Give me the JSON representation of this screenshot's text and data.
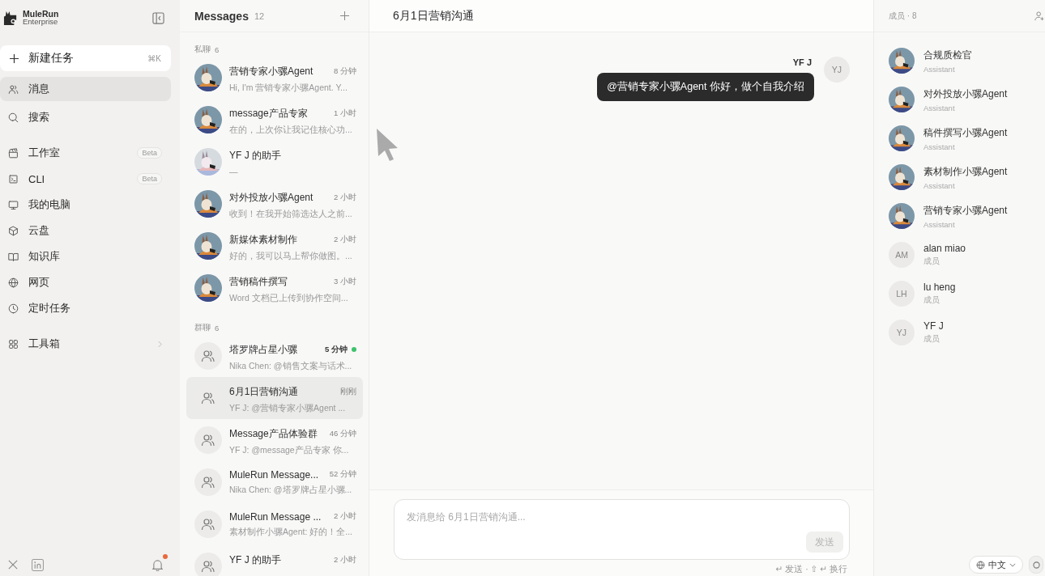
{
  "sidebar": {
    "logo": {
      "name": "MuleRun",
      "edition": "Enterprise"
    },
    "new_task": {
      "label": "新建任务",
      "shortcut": "⌘K"
    },
    "nav_groups": [
      [
        {
          "label": "消息",
          "selected": true,
          "expandable": false
        },
        {
          "label": "搜索",
          "selected": false,
          "expandable": false
        }
      ],
      [
        {
          "label": "工作室",
          "selected": false,
          "expandable": false,
          "badge": "Beta"
        },
        {
          "label": "CLI",
          "selected": false,
          "expandable": false,
          "badge": "Beta"
        },
        {
          "label": "我的电脑",
          "selected": false,
          "expandable": false
        },
        {
          "label": "云盘",
          "selected": false,
          "expandable": false
        },
        {
          "label": "知识库",
          "selected": false,
          "expandable": false
        },
        {
          "label": "网页",
          "selected": false,
          "expandable": false
        },
        {
          "label": "定时任务",
          "selected": false,
          "expandable": false
        }
      ],
      [
        {
          "label": "工具箱",
          "selected": false,
          "expandable": true
        }
      ]
    ],
    "footer": {
      "notification_dot": true
    }
  },
  "message_list": {
    "title": "Messages",
    "count": "12",
    "sections": [
      {
        "label": "私聊",
        "count": "6",
        "items": [
          {
            "kind": "mule",
            "title": "营销专家小骡Agent",
            "time": "8 分钟",
            "preview": "Hi, I'm 营销专家小骡Agent. Y...",
            "selected": false,
            "unread": false
          },
          {
            "kind": "mule",
            "title": "message产品专家",
            "time": "1 小时",
            "preview": "在的，上次你让我记住核心功...",
            "selected": false,
            "unread": false
          },
          {
            "kind": "mule_light",
            "title": "YF J 的助手",
            "preview": "—",
            "selected": false,
            "unread": false
          },
          {
            "kind": "mule",
            "title": "对外投放小骡Agent",
            "time": "2 小时",
            "preview": "收到！在我开始筛选达人之前...",
            "selected": false,
            "unread": false
          },
          {
            "kind": "mule",
            "title": "新媒体素材制作",
            "time": "2 小时",
            "preview": "好的，我可以马上帮你做图。...",
            "selected": false,
            "unread": false
          },
          {
            "kind": "mule",
            "title": "营销稿件撰写",
            "time": "3 小时",
            "preview": "Word 文档已上传到协作空间...",
            "selected": false,
            "unread": false
          }
        ]
      },
      {
        "label": "群聊",
        "count": "6",
        "items": [
          {
            "kind": "group",
            "title": "塔罗牌占星小骡",
            "time": "5 分钟",
            "preview": "Nika Chen: @销售文案与话术...",
            "selected": false,
            "unread": true
          },
          {
            "kind": "group",
            "title": "6月1日营销沟通",
            "time": "刚刚",
            "preview": "YF J: @营销专家小骡Agent ...",
            "selected": true,
            "unread": false
          },
          {
            "kind": "group",
            "title": "Message产品体验群",
            "time": "46 分钟",
            "preview": "YF J: @message产品专家 你...",
            "selected": false,
            "unread": false
          },
          {
            "kind": "group",
            "title": "MuleRun Message...",
            "time": "52 分钟",
            "preview": "Nika Chen: @塔罗牌占星小骡...",
            "selected": false,
            "unread": false
          },
          {
            "kind": "group",
            "title": "MuleRun Message ...",
            "time": "2 小时",
            "preview": "素材制作小骡Agent: 好的！全...",
            "selected": false,
            "unread": false
          },
          {
            "kind": "group",
            "title": "YF J 的助手",
            "time": "2 小时",
            "selected": false,
            "unread": false
          }
        ]
      }
    ]
  },
  "chat": {
    "title": "6月1日营销沟通",
    "messages": [
      {
        "sender": "YF J",
        "initials": "YJ",
        "text": "@营销专家小骡Agent 你好，做个自我介绍"
      }
    ],
    "composer": {
      "placeholder": "发消息给 6月1日营销沟通...",
      "send_button": {
        "label": "发送",
        "disabled": true
      },
      "hint": "↵ 发送 · ⇧ ↵ 换行"
    }
  },
  "members_panel": {
    "title": "成员 · 8",
    "members": [
      {
        "kind": "mule",
        "name": "合规质检官",
        "role": "Assistant"
      },
      {
        "kind": "mule",
        "name": "对外投放小骡Agent",
        "role": "Assistant"
      },
      {
        "kind": "mule",
        "name": "稿件撰写小骡Agent",
        "role": "Assistant"
      },
      {
        "kind": "mule",
        "name": "素材制作小骡Agent",
        "role": "Assistant"
      },
      {
        "kind": "mule",
        "name": "营销专家小骡Agent",
        "role": "Assistant"
      },
      {
        "kind": "initials",
        "initials": "AM",
        "name": "alan miao",
        "role": "成员"
      },
      {
        "kind": "initials",
        "initials": "LH",
        "name": "lu heng",
        "role": "成员"
      },
      {
        "kind": "initials",
        "initials": "YJ",
        "name": "YF J",
        "role": "成员"
      }
    ]
  },
  "language": {
    "label": "中文"
  }
}
